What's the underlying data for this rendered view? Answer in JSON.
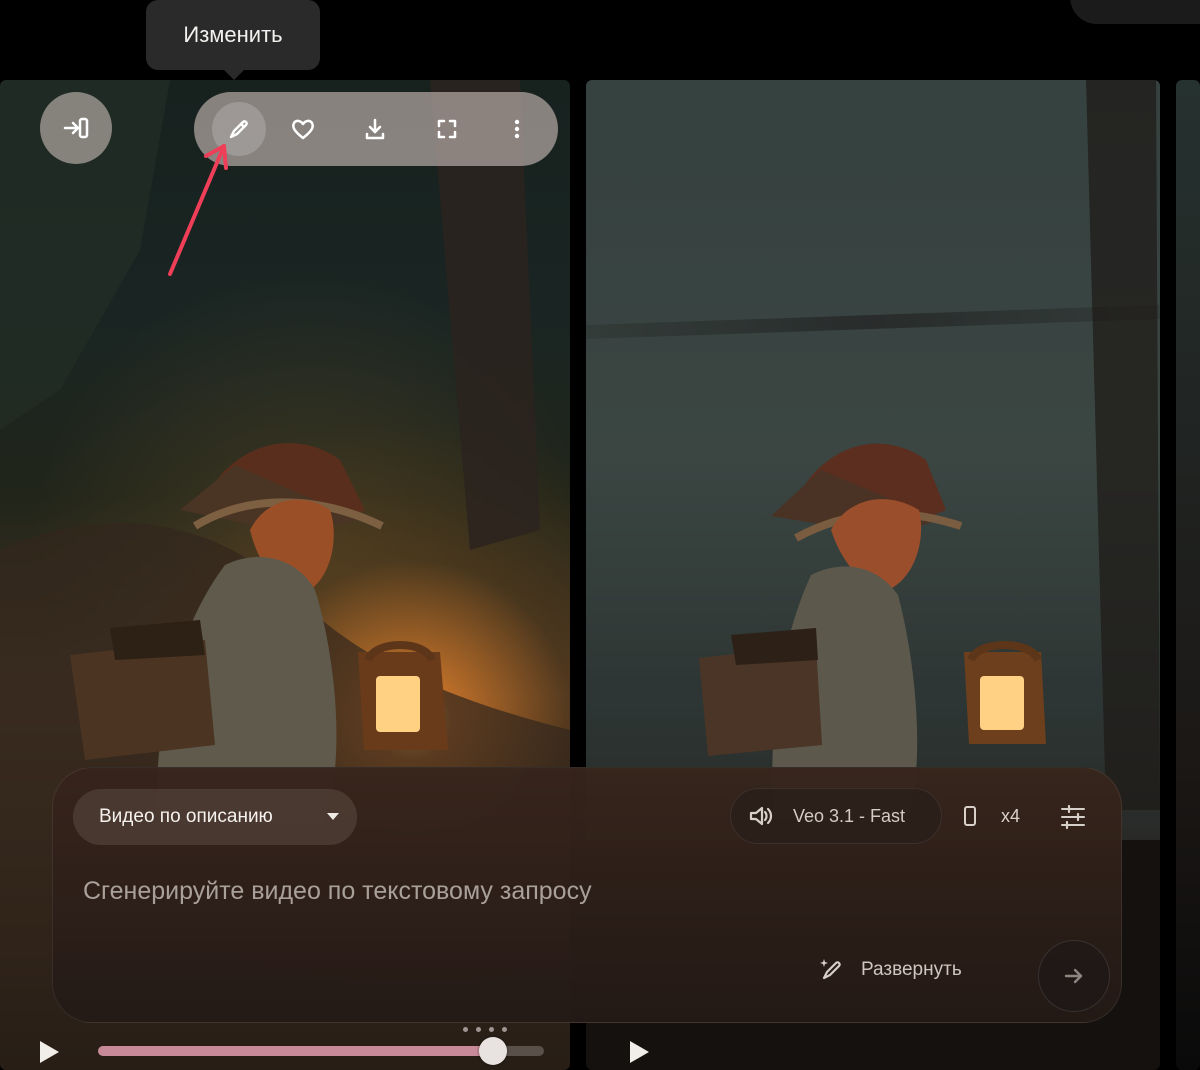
{
  "tooltip": {
    "text": "Изменить"
  },
  "toolbar": {
    "items": [
      {
        "name": "edit-button",
        "icon": "pencil-icon"
      },
      {
        "name": "favorite-button",
        "icon": "heart-icon"
      },
      {
        "name": "download-button",
        "icon": "download-icon"
      },
      {
        "name": "fullscreen-button",
        "icon": "fullscreen-icon"
      },
      {
        "name": "more-button",
        "icon": "more-vertical-icon"
      }
    ]
  },
  "composer": {
    "mode_label": "Видео по описанию",
    "model_label": "Veo 3.1 - Fast",
    "count_label": "x4",
    "prompt_placeholder": "Сгенерируйте видео по текстовому запросу",
    "expand_label": "Развернуть"
  },
  "player": {
    "progress": 0.885
  },
  "colors": {
    "accent": "#c88a98",
    "panel": "#2f241f"
  }
}
